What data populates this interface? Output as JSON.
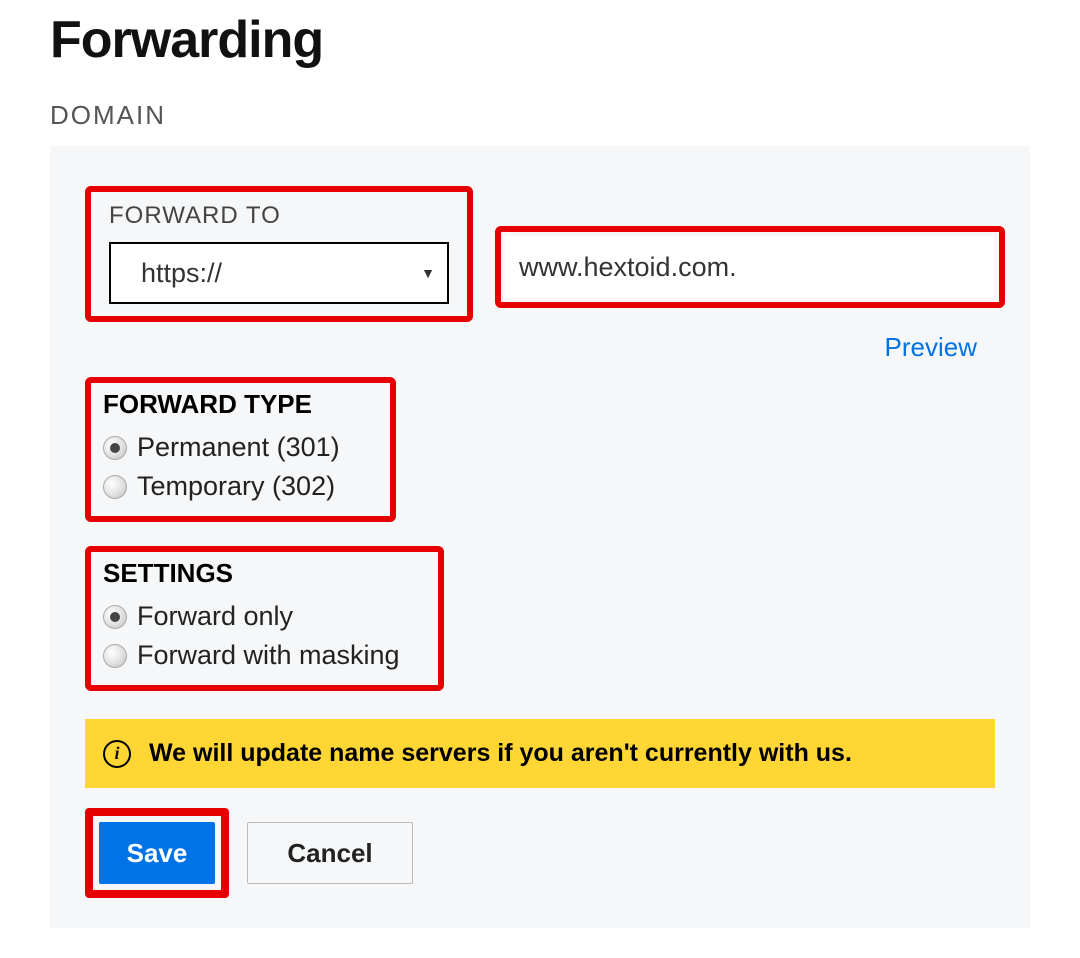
{
  "header": {
    "title": "Forwarding",
    "domain_label": "DOMAIN"
  },
  "forward_to": {
    "label": "FORWARD TO",
    "protocol": "https://",
    "url_value": "www.hextoid.com.",
    "preview": "Preview"
  },
  "forward_type": {
    "label": "FORWARD TYPE",
    "options": {
      "permanent": "Permanent (301)",
      "temporary": "Temporary (302)"
    },
    "selected": "permanent"
  },
  "settings": {
    "label": "SETTINGS",
    "options": {
      "forward_only": "Forward only",
      "forward_masking": "Forward with masking"
    },
    "selected": "forward_only"
  },
  "banner": {
    "text": "We will update name servers if you aren't currently with us."
  },
  "buttons": {
    "save": "Save",
    "cancel": "Cancel"
  }
}
